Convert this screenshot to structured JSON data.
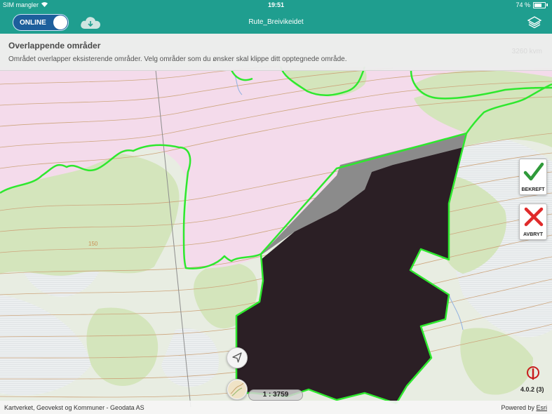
{
  "status_bar": {
    "carrier": "SIM mangler",
    "time": "19:51",
    "battery": "74 %"
  },
  "nav": {
    "toggle_label": "ONLINE",
    "title": "Rute_Breivikeidet",
    "cloud_icon": "cloud-download-icon",
    "layers_icon": "layers-icon"
  },
  "banner": {
    "title": "Overlappende områder",
    "text": "Området overlapper eksisterende områder. Velg områder som du ønsker skal klippe ditt opptegnede område.",
    "area": "3260 kvm"
  },
  "map": {
    "contour_label": "150",
    "colors": {
      "land": "#e9eee5",
      "forest": "#d6e6bf",
      "pink_area": "#f3dbeb",
      "boundary_green": "#2ee82e",
      "drawn_area": "#2b1f25",
      "overlap_grey": "#8a8a8a",
      "contour": "#c9a37a"
    }
  },
  "actions": {
    "confirm_label": "BEKREFT",
    "cancel_label": "AVBRYT"
  },
  "scale": "1 : 3759",
  "version": "4.0.2 (3)",
  "footer": {
    "attribution": "Kartverket, Geovekst og Kommuner - Geodata AS",
    "powered_prefix": "Powered by ",
    "powered_link": "Esri"
  }
}
